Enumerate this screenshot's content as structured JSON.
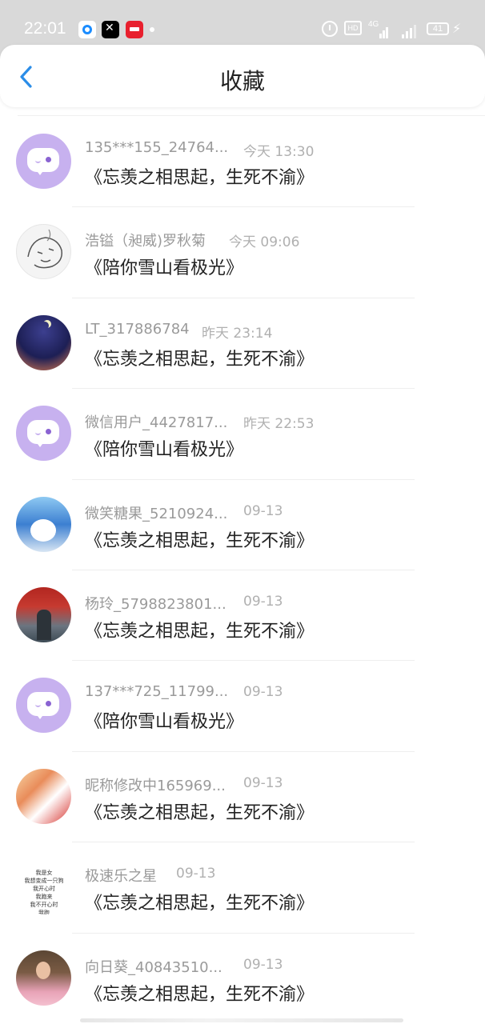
{
  "status_bar": {
    "time": "22:01",
    "network": "4G",
    "hd": "HD",
    "battery": "41"
  },
  "header": {
    "title": "收藏"
  },
  "items": [
    {
      "name": "135***155_24764...",
      "time": "今天 13:30",
      "title": "《忘羡之相思起，生死不渝》",
      "avatar": "default-chat-icon"
    },
    {
      "name": "浩镒（昶威)罗秋菊",
      "time": "今天 09:06",
      "title": "《陪你雪山看极光》",
      "avatar": "sketch-avatar"
    },
    {
      "name": "LT_317886784",
      "time": "昨天 23:14",
      "title": "《忘羡之相思起，生死不渝》",
      "avatar": "night-sky-avatar"
    },
    {
      "name": "微信用户_4427817...",
      "time": "昨天 22:53",
      "title": "《陪你雪山看极光》",
      "avatar": "default-chat-icon"
    },
    {
      "name": "微笑糖果_5210924...",
      "time": "09-13",
      "title": "《忘羡之相思起，生死不渝》",
      "avatar": "doraemon-avatar"
    },
    {
      "name": "杨玲_5798823801...",
      "time": "09-13",
      "title": "《忘羡之相思起，生死不渝》",
      "avatar": "shop-front-avatar"
    },
    {
      "name": "137***725_11799...",
      "time": "09-13",
      "title": "《陪你雪山看极光》",
      "avatar": "default-chat-icon"
    },
    {
      "name": "昵称修改中165969...",
      "time": "09-13",
      "title": "《忘羡之相思起，生死不渝》",
      "avatar": "poster-avatar"
    },
    {
      "name": "极速乐之星",
      "time": "09-13",
      "title": "《忘羡之相思起，生死不渝》",
      "avatar": "text-avatar",
      "avatar_text": "我是女\n我想变成一只狗\n我开心时\n我跑来\n我不开心时\n我跑"
    },
    {
      "name": "向日葵_40843510...",
      "time": "09-13",
      "title": "《忘羡之相思起，生死不渝》",
      "avatar": "girl-photo-avatar"
    }
  ]
}
